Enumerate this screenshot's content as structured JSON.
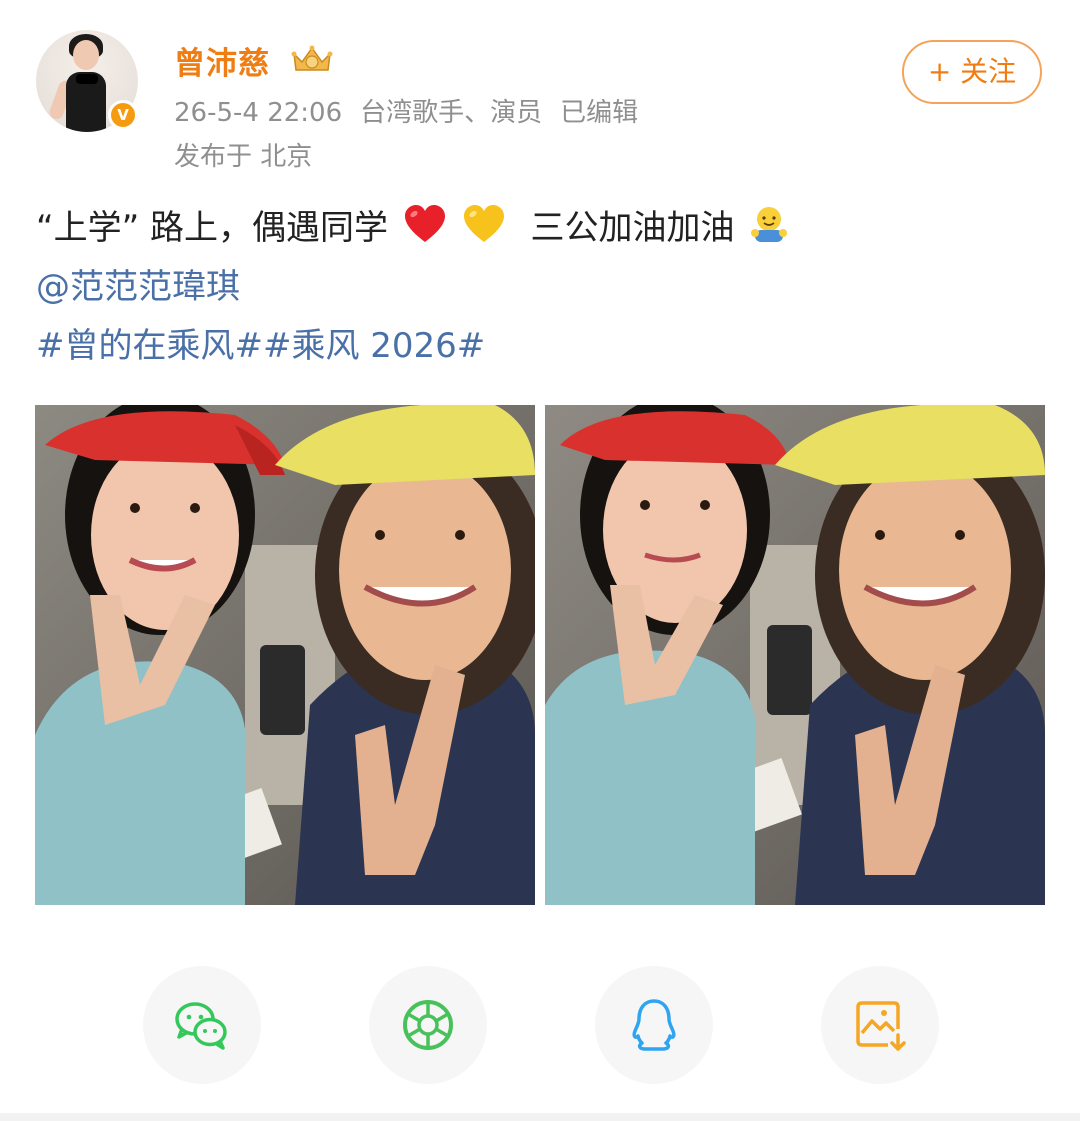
{
  "header": {
    "username": "曾沛慈",
    "verified_badge": "V",
    "timestamp": "26-5-4 22:06",
    "description": "台湾歌手、演员",
    "edited": "已编辑",
    "location": "发布于 北京",
    "follow_label": "+ 关注"
  },
  "post": {
    "text_part1": "“上学” 路上，偶遇同学",
    "text_part2": "三公加油加油",
    "mention": "@范范范瑋琪",
    "hashtag1": "#曾的在乘风#",
    "hashtag2": "#乘风 2026#",
    "emoji": [
      "red-heart",
      "yellow-heart",
      "hug-emoji"
    ]
  },
  "photos": [
    {
      "name": "selfie-photo-1"
    },
    {
      "name": "selfie-photo-2"
    }
  ],
  "share_bar": [
    {
      "icon": "wechat-icon"
    },
    {
      "icon": "moments-icon"
    },
    {
      "icon": "qq-icon"
    },
    {
      "icon": "save-image-icon"
    }
  ],
  "colors": {
    "accent": "#f07d13",
    "link": "#4a70a8",
    "meta": "#8f8f8f",
    "wechat": "#34c85a",
    "moments": "#49c15a",
    "qq": "#2fa4f0",
    "save": "#f5a623"
  }
}
